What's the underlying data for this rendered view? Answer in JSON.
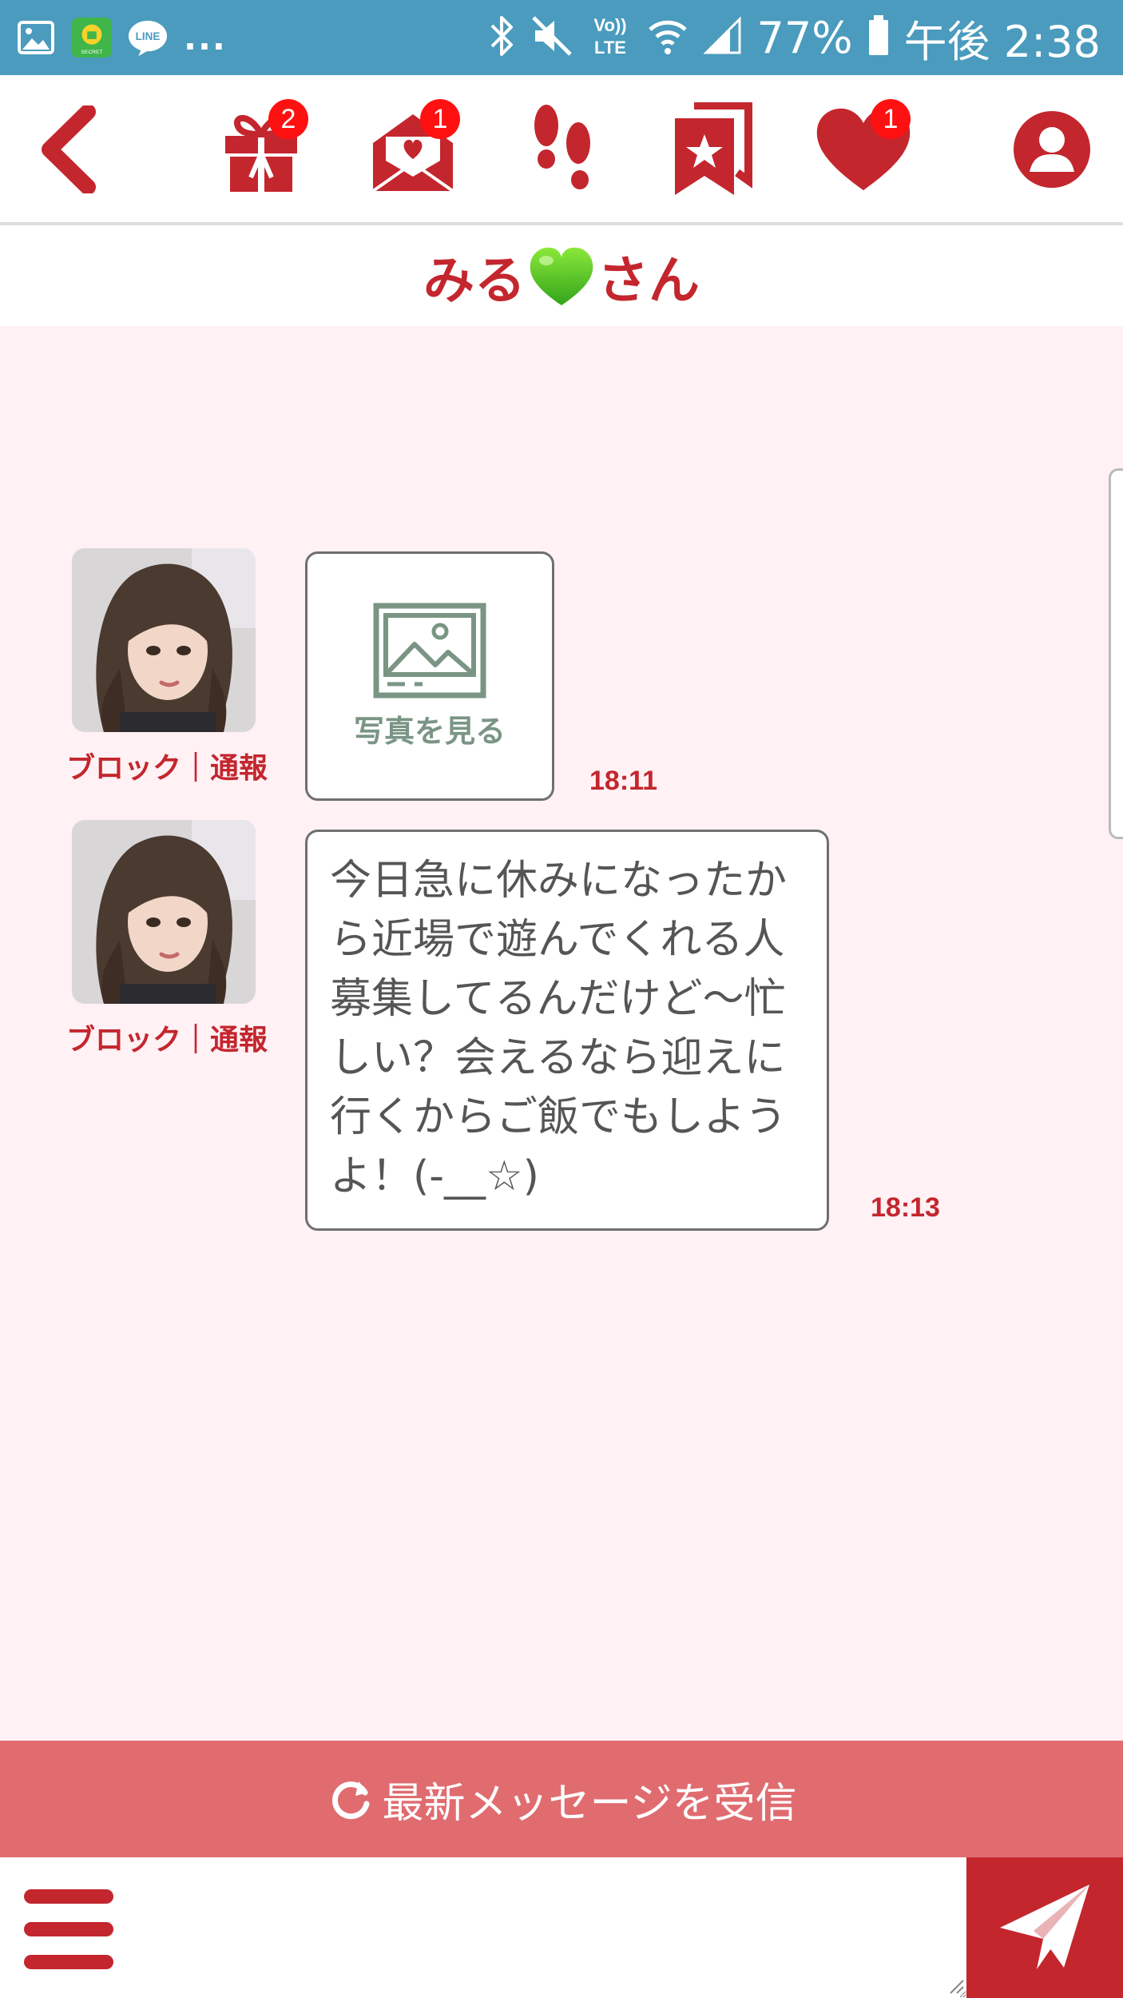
{
  "status_bar": {
    "battery_percent": "77%",
    "time": "午後 2:38",
    "notifications_more": "...",
    "line_label": "LINE",
    "lte_label": "LTE",
    "volte_label": "Vo))"
  },
  "nav": {
    "gift_badge": "2",
    "mail_badge": "1",
    "like_badge": "1"
  },
  "title": {
    "name_prefix": "みる",
    "suffix": "さん"
  },
  "messages": [
    {
      "type": "photo",
      "photo_label": "写真を見る",
      "links": "ブロック｜通報",
      "time": "18:11"
    },
    {
      "type": "text",
      "text": "今日急に休みになったか\nら近場で遊んでくれる人\n募集してるんだけど～忙\nしい？会えるなら迎えに\n行くからご飯でもしよう\nよ！(-__☆)",
      "links": "ブロック｜通報",
      "time": "18:13"
    }
  ],
  "refresh_label": "最新メッセージを受信",
  "input": {
    "placeholder": ""
  },
  "colors": {
    "brand_red": "#c4262e",
    "status_bar": "#4a9bbd",
    "chat_bg": "#fff1f4",
    "refresh_bg": "#e06c70",
    "badge_red": "#ff1111"
  },
  "icons": {
    "back": "chevron-left-icon",
    "gift": "gift-icon",
    "mail": "heart-envelope-icon",
    "footprints": "footprints-icon",
    "favorites": "bookmark-star-icon",
    "like": "heart-icon",
    "profile": "user-icon",
    "refresh": "refresh-icon",
    "menu": "hamburger-menu-icon",
    "send": "paper-plane-icon"
  }
}
